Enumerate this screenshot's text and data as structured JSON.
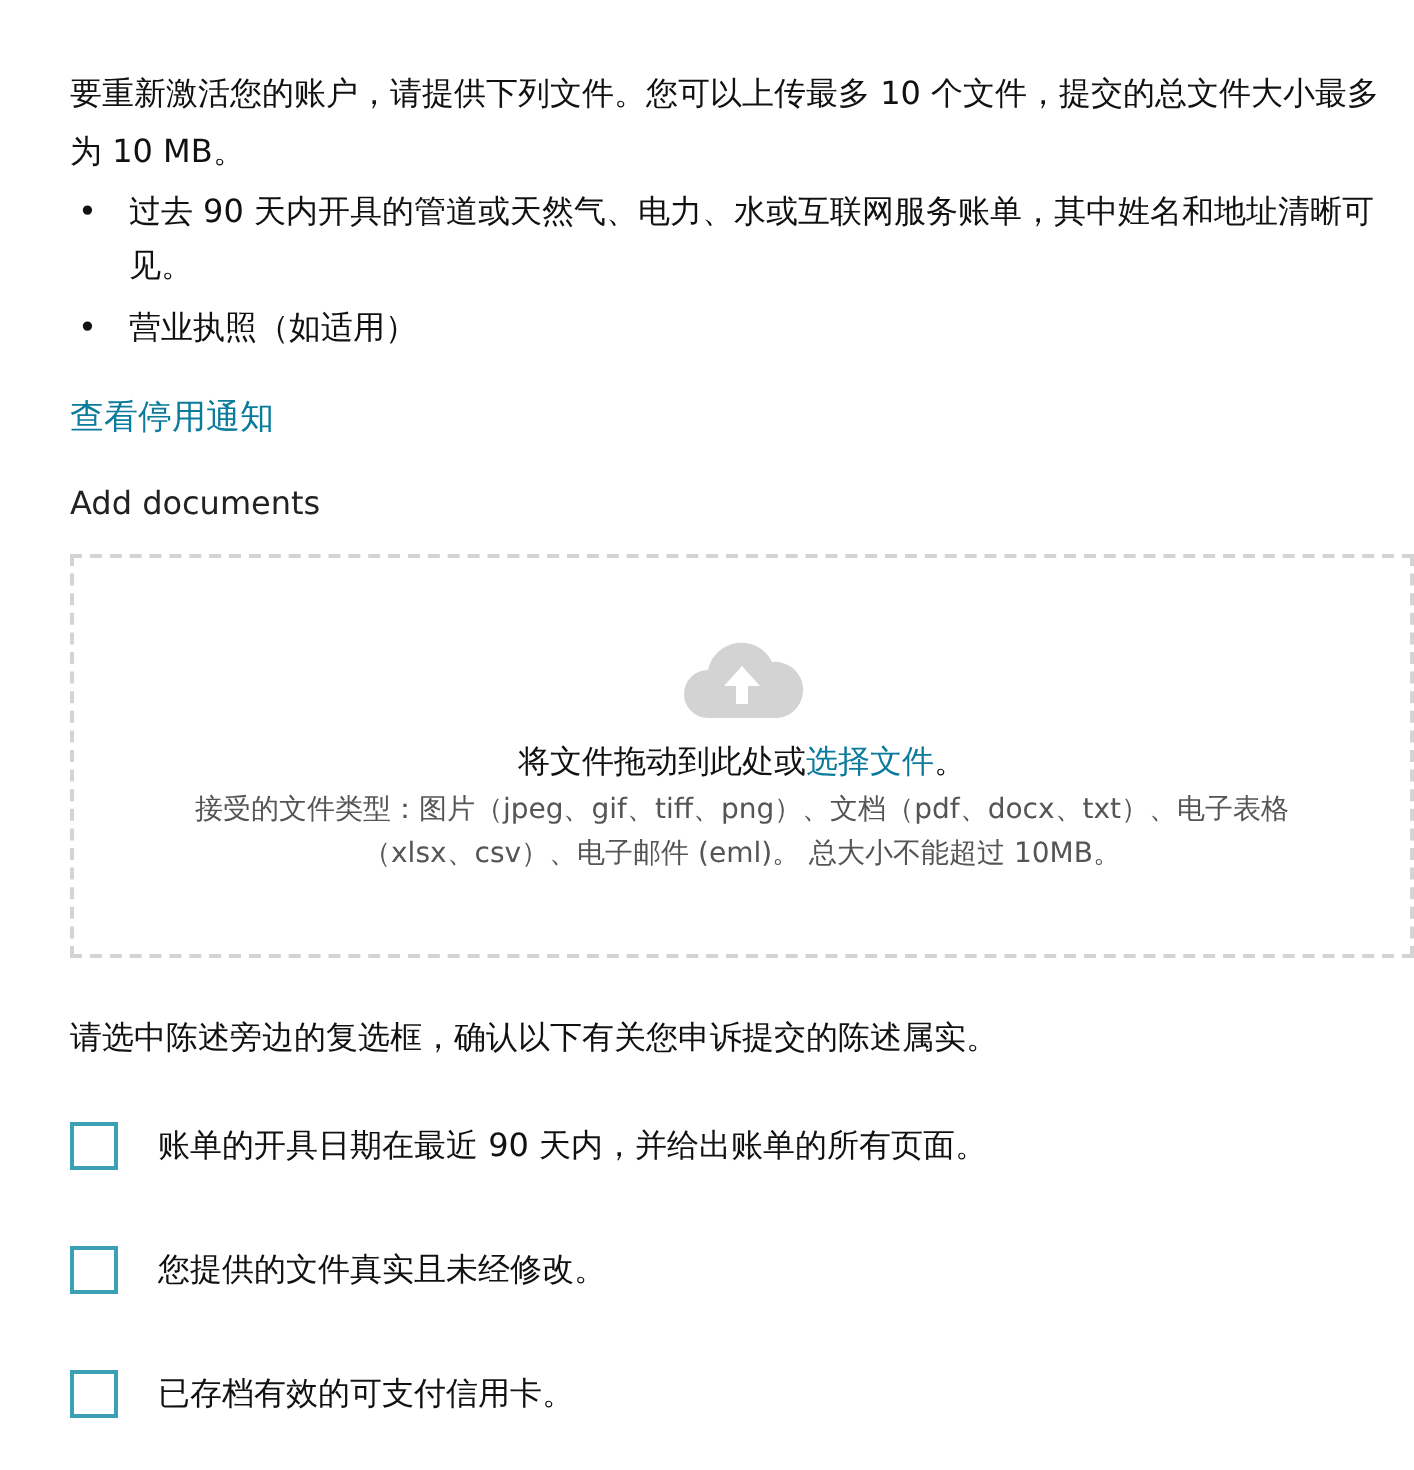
{
  "intro": "要重新激活您的账户，请提供下列文件。您可以上传最多 10 个文件，提交的总文件大小最多为 10 MB。",
  "requirements": [
    {
      "marker": "•",
      "text": "过去 90 天内开具的管道或天然气、电力、水或互联网服务账单，其中姓名和地址清晰可见。"
    },
    {
      "marker": "•",
      "text": "营业执照（如适用）"
    }
  ],
  "notice_link": "查看停用通知",
  "upload": {
    "label": "Add documents",
    "prompt_before": "将文件拖动到此处或",
    "prompt_link": "选择文件",
    "prompt_after": "。",
    "accepted": "接受的文件类型：图片（jpeg、gif、tiff、png）、文档（pdf、docx、txt）、电子表格（xlsx、csv）、电子邮件 (eml)。 总大小不能超过 10MB。"
  },
  "confirm_prompt": "请选中陈述旁边的复选框，确认以下有关您申诉提交的陈述属实。",
  "statements": [
    {
      "label": "账单的开具日期在最近 90 天内，并给出账单的所有页面。",
      "checked": false
    },
    {
      "label": "您提供的文件真实且未经修改。",
      "checked": false
    },
    {
      "label": "已存档有效的可支付信用卡。",
      "checked": false
    }
  ]
}
